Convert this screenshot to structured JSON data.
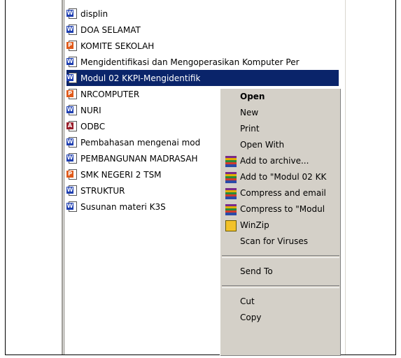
{
  "files": [
    {
      "name": "displin",
      "icon": "word-document-icon",
      "badge": "W",
      "type": "word"
    },
    {
      "name": "DOA SELAMAT",
      "icon": "word-document-icon",
      "badge": "W",
      "type": "word"
    },
    {
      "name": "KOMITE SEKOLAH",
      "icon": "powerpoint-document-icon",
      "badge": "P",
      "type": "ppt"
    },
    {
      "name": "Mengidentifikasi dan Mengoperasikan Komputer Per",
      "icon": "word-document-icon",
      "badge": "W",
      "type": "word"
    },
    {
      "name": "Modul 02 KKPI-Mengidentifik",
      "icon": "word-document-icon",
      "badge": "W",
      "type": "word",
      "selected": true
    },
    {
      "name": "NRCOMPUTER",
      "icon": "powerpoint-document-icon",
      "badge": "P",
      "type": "ppt"
    },
    {
      "name": "NURI",
      "icon": "word-document-icon",
      "badge": "W",
      "type": "word"
    },
    {
      "name": "ODBC",
      "icon": "access-document-icon",
      "badge": "A",
      "type": "acc"
    },
    {
      "name": "Pembahasan mengenai mod",
      "icon": "word-document-icon",
      "badge": "W",
      "type": "word"
    },
    {
      "name": "PEMBANGUNAN MADRASAH",
      "icon": "word-document-icon",
      "badge": "W",
      "type": "word"
    },
    {
      "name": "SMK NEGERI 2 TSM",
      "icon": "powerpoint-document-icon",
      "badge": "P",
      "type": "ppt"
    },
    {
      "name": "STRUKTUR",
      "icon": "word-document-icon",
      "badge": "W",
      "type": "word"
    },
    {
      "name": "Susunan materi K3S",
      "icon": "word-document-icon",
      "badge": "W",
      "type": "word"
    }
  ],
  "context_menu": {
    "open": "Open",
    "new": "New",
    "print": "Print",
    "open_with": "Open With",
    "add_to_archive": "Add to archive...",
    "add_to_named": "Add to \"Modul 02 KK",
    "compress_email": "Compress and email",
    "compress_to": "Compress to \"Modul",
    "winzip": "WinZip",
    "scan": "Scan for Viruses",
    "send_to": "Send To",
    "cut": "Cut",
    "copy": "Copy"
  },
  "colors": {
    "selection": "#0a246a",
    "menu_background": "#d4d0c8"
  }
}
